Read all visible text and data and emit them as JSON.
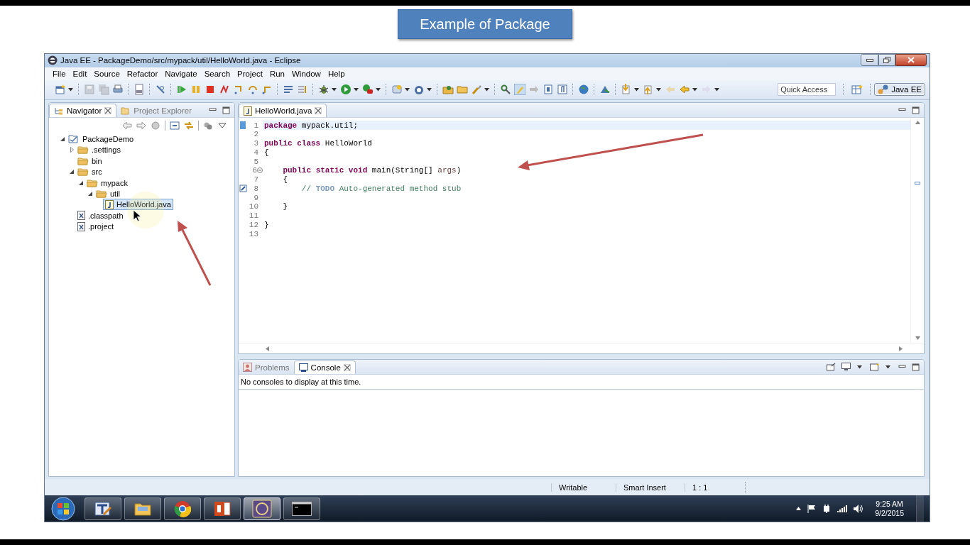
{
  "slide_title": "Example of Package",
  "window": {
    "title": "Java EE - PackageDemo/src/mypack/util/HelloWorld.java - Eclipse"
  },
  "menu": [
    {
      "label": "File"
    },
    {
      "label": "Edit"
    },
    {
      "label": "Source"
    },
    {
      "label": "Refactor"
    },
    {
      "label": "Navigate"
    },
    {
      "label": "Search"
    },
    {
      "label": "Project"
    },
    {
      "label": "Run"
    },
    {
      "label": "Window"
    },
    {
      "label": "Help"
    }
  ],
  "toolbar": {
    "quick_access": {
      "placeholder": "Quick Access"
    },
    "perspective": {
      "label": "Java EE",
      "selected": true
    }
  },
  "left_panel": {
    "tabs": [
      {
        "label": "Navigator",
        "selected": true
      },
      {
        "label": "Project Explorer",
        "selected": false
      }
    ],
    "tree": [
      {
        "label": "PackageDemo",
        "kind": "project",
        "expanded": true,
        "selected": false,
        "children": [
          {
            "label": ".settings",
            "kind": "folder",
            "expanded": false,
            "selected": false
          },
          {
            "label": "bin",
            "kind": "folder",
            "selected": false
          },
          {
            "label": "src",
            "kind": "folder",
            "expanded": true,
            "selected": false,
            "children": [
              {
                "label": "mypack",
                "kind": "folder",
                "expanded": true,
                "selected": false,
                "children": [
                  {
                    "label": "util",
                    "kind": "folder",
                    "expanded": true,
                    "selected": false,
                    "children": [
                      {
                        "label": "HelloWorld.java",
                        "kind": "java",
                        "selected": true
                      }
                    ]
                  }
                ]
              }
            ]
          },
          {
            "label": ".classpath",
            "kind": "xml",
            "selected": false
          },
          {
            "label": ".project",
            "kind": "xml",
            "selected": false
          }
        ]
      }
    ]
  },
  "editor": {
    "tabs": [
      {
        "label": "HelloWorld.java",
        "selected": true
      }
    ],
    "lines": [
      {
        "number": "1",
        "current": true,
        "tokens": [
          {
            "kind": "keyword",
            "text": "package "
          },
          {
            "kind": "plain",
            "text": "mypack.util;"
          }
        ]
      },
      {
        "number": "2",
        "current": false
      },
      {
        "number": "3",
        "current": false,
        "tokens": [
          {
            "kind": "keyword",
            "text": "public "
          },
          {
            "kind": "keyword",
            "text": "class "
          },
          {
            "kind": "plain",
            "text": "HelloWorld"
          }
        ]
      },
      {
        "number": "4",
        "current": false,
        "tokens": [
          {
            "kind": "plain",
            "text": "{"
          }
        ]
      },
      {
        "number": "5",
        "current": false
      },
      {
        "number": "6",
        "current": false,
        "kind": "fold",
        "tokens": [
          {
            "kind": "keyword",
            "text": "    public "
          },
          {
            "kind": "keyword",
            "text": "static "
          },
          {
            "kind": "keyword",
            "text": "void "
          },
          {
            "kind": "plain",
            "text": "main(String[] "
          },
          {
            "kind": "param",
            "text": "args"
          },
          {
            "kind": "plain",
            "text": ")"
          }
        ]
      },
      {
        "number": "7",
        "current": false,
        "tokens": [
          {
            "kind": "plain",
            "text": "    {"
          }
        ]
      },
      {
        "number": "8",
        "current": false,
        "kind": "task",
        "tokens": [
          {
            "kind": "comment",
            "text": "        // "
          },
          {
            "kind": "tasktag",
            "text": "TODO"
          },
          {
            "kind": "comment",
            "text": " Auto-generated method stub"
          }
        ]
      },
      {
        "number": "9",
        "current": false
      },
      {
        "number": "10",
        "current": false,
        "tokens": [
          {
            "kind": "plain",
            "text": "    }"
          }
        ]
      },
      {
        "number": "11",
        "current": false
      },
      {
        "number": "12",
        "current": false,
        "tokens": [
          {
            "kind": "plain",
            "text": "}"
          }
        ]
      },
      {
        "number": "13",
        "current": false
      }
    ]
  },
  "bottom_panel": {
    "tabs": [
      {
        "label": "Problems",
        "selected": false
      },
      {
        "label": "Console",
        "selected": true
      }
    ],
    "message": "No consoles to display at this time."
  },
  "status_bar": [
    "Writable",
    "Smart Insert",
    "1 : 1"
  ],
  "taskbar": {
    "apps": [
      {
        "kind": "tool",
        "selected": false
      },
      {
        "kind": "files",
        "selected": false
      },
      {
        "kind": "browser",
        "selected": false
      },
      {
        "kind": "slides",
        "selected": false
      },
      {
        "kind": "ide",
        "selected": true
      },
      {
        "kind": "terminal",
        "selected": false
      }
    ],
    "clock": {
      "time": "9:25 AM",
      "date": "9/2/2015"
    }
  }
}
